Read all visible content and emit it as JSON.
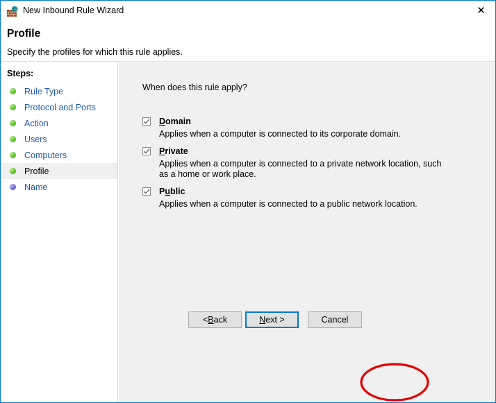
{
  "window": {
    "title": "New Inbound Rule Wizard",
    "title_icon": "firewall-brick-wall-globe-icon",
    "close_label": "✕",
    "border_color": "#0078d7"
  },
  "header": {
    "title": "Profile",
    "subtitle": "Specify the profiles for which this rule applies."
  },
  "sidebar": {
    "heading": "Steps:",
    "items": [
      {
        "label": "Rule Type",
        "bullet": "green",
        "current": false
      },
      {
        "label": "Protocol and Ports",
        "bullet": "green",
        "current": false
      },
      {
        "label": "Action",
        "bullet": "green",
        "current": false
      },
      {
        "label": "Users",
        "bullet": "green",
        "current": false
      },
      {
        "label": "Computers",
        "bullet": "green",
        "current": false
      },
      {
        "label": "Profile",
        "bullet": "green",
        "current": true
      },
      {
        "label": "Name",
        "bullet": "blue",
        "current": false
      }
    ],
    "link_color": "#1e5aa8",
    "current_color": "#000000"
  },
  "main": {
    "question": "When does this rule apply?",
    "options": [
      {
        "name": "domain",
        "label_pre": "",
        "label_accel": "D",
        "label_post": "omain",
        "checked": true,
        "description": "Applies when a computer is connected to its corporate domain."
      },
      {
        "name": "private",
        "label_pre": "",
        "label_accel": "P",
        "label_post": "rivate",
        "checked": true,
        "description": "Applies when a computer is connected to a private network location, such as a home or work place."
      },
      {
        "name": "public",
        "label_pre": "P",
        "label_accel": "u",
        "label_post": "blic",
        "checked": true,
        "description": "Applies when a computer is connected to a public network location."
      }
    ]
  },
  "footer": {
    "back_pre": "< ",
    "back_accel": "B",
    "back_post": "ack",
    "next_pre": "",
    "next_accel": "N",
    "next_post": "ext >",
    "cancel_label": "Cancel",
    "focused_button": "Next >",
    "focus_color": "#0078d7"
  },
  "annotation": {
    "shape": "ellipse",
    "color": "#e00000",
    "target": "Next >"
  }
}
